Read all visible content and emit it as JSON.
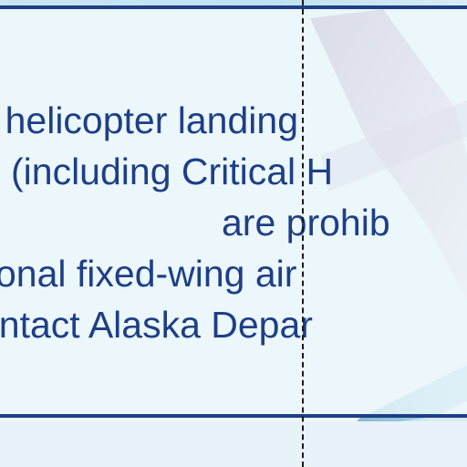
{
  "sign": {
    "lines": [
      "ll helicopter landing",
      "(including Critical H",
      "are prohib",
      "onal fixed-wing air",
      "ontact Alaska Depar"
    ]
  },
  "colors": {
    "text": "#1e3f86",
    "border": "#1e3f86",
    "background": "#eef6fb",
    "divider": "#1a1a1a"
  }
}
